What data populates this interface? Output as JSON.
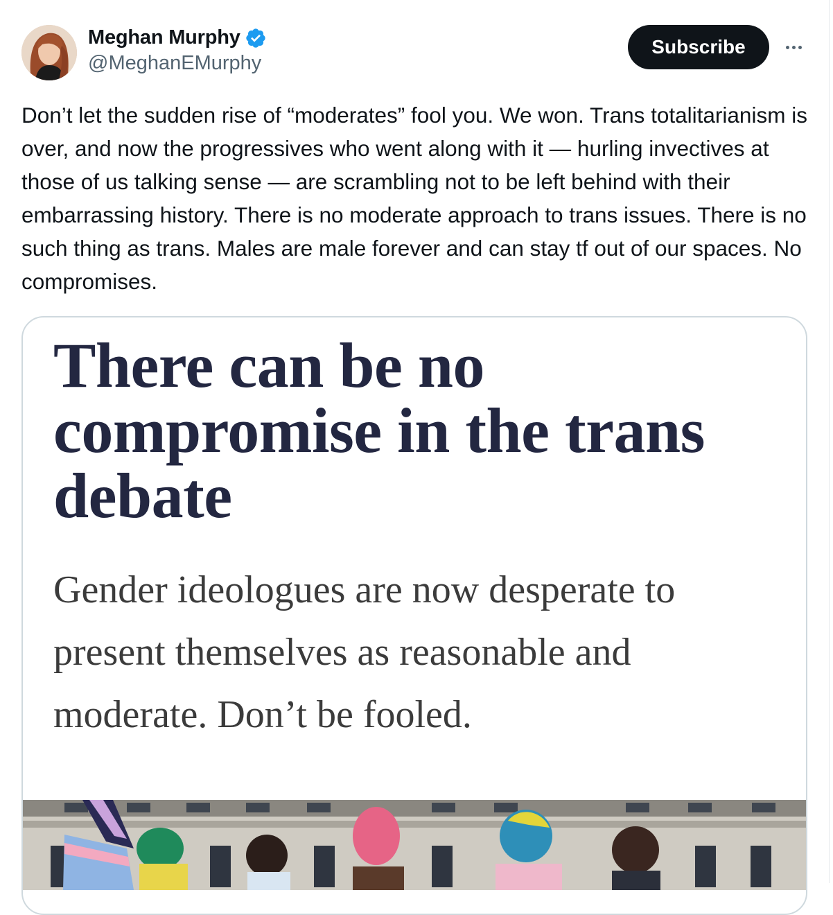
{
  "author": {
    "display_name": "Meghan Murphy",
    "handle": "@MeghanEMurphy",
    "verified_color": "#1d9bf0"
  },
  "actions": {
    "subscribe_label": "Subscribe",
    "more_icon": "more-horizontal-icon"
  },
  "tweet": {
    "text": "Don’t let the sudden rise of “moderates” fool you. We won. Trans totalitarianism is over, and now the progressives who went along with it — hurling invectives at those of us talking sense — are scrambling not to be left behind with their embarrassing history. There is no moderate approach to trans issues. There is no such thing as trans. Males are male forever and can stay tf out of our spaces. No compromises."
  },
  "card": {
    "headline": "There can be no compromise in the trans debate",
    "standfirst": "Gender ideologues are now desperate to present themselves as reasonable and moderate. Don’t be fooled."
  },
  "colors": {
    "text": "#0f1419",
    "secondary": "#536471",
    "headline": "#232741"
  }
}
